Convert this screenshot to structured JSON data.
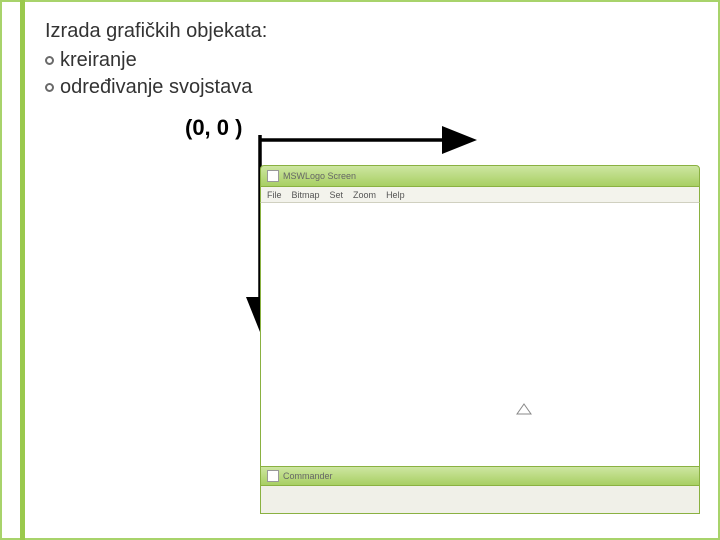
{
  "heading": "Izrada grafičkih objekata:",
  "bullets": [
    "kreiranje",
    "određivanje svojstava"
  ],
  "origin_label": "(0, 0 )",
  "window": {
    "title": "MSWLogo Screen",
    "menu": [
      "File",
      "Bitmap",
      "Set",
      "Zoom",
      "Help"
    ],
    "commander_title": "Commander"
  }
}
